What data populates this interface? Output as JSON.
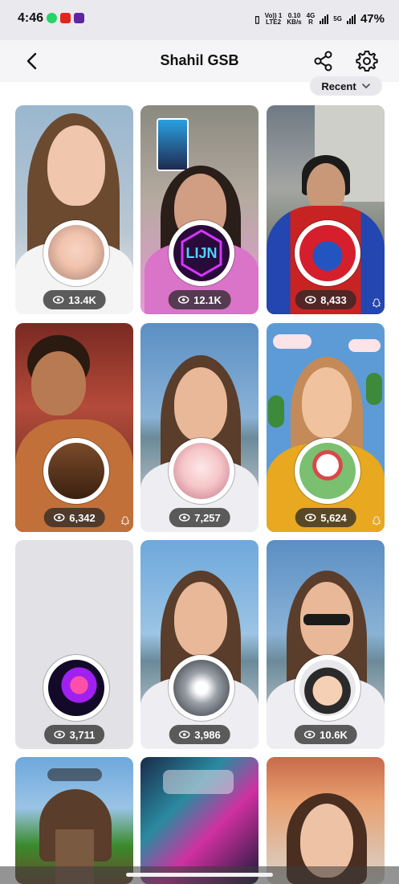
{
  "status_bar": {
    "time": "4:46",
    "network_top": "Vo)) 1",
    "network_bottom": "LTE2",
    "speed_top": "0.10",
    "speed_bottom": "KB/s",
    "g4_top": "4G",
    "g4_bottom": "R",
    "g5": "5G",
    "battery": "47%"
  },
  "header": {
    "title": "Shahil GSB"
  },
  "sort": {
    "label": "Recent"
  },
  "cards": [
    {
      "views": "13.4K",
      "lens_icon": "makeup-face-icon"
    },
    {
      "views": "12.1K",
      "lens_icon": "lijn-neon-icon",
      "lens_text": "LIJN"
    },
    {
      "views": "8,433",
      "lens_icon": "spiderman-mask-icon"
    },
    {
      "views": "6,342",
      "lens_icon": "wooden-puppet-icon"
    },
    {
      "views": "7,257",
      "lens_icon": "glow-face-icon"
    },
    {
      "views": "5,624",
      "lens_icon": "castle-village-icon"
    },
    {
      "views": "3,711",
      "lens_icon": "neon-flower-icon"
    },
    {
      "views": "3,986",
      "lens_icon": "light-burst-icon"
    },
    {
      "views": "10.6K",
      "lens_icon": "cartoon-avatar-icon"
    }
  ],
  "colors": {
    "accent": "#111111",
    "badge_bg": "#282828"
  }
}
